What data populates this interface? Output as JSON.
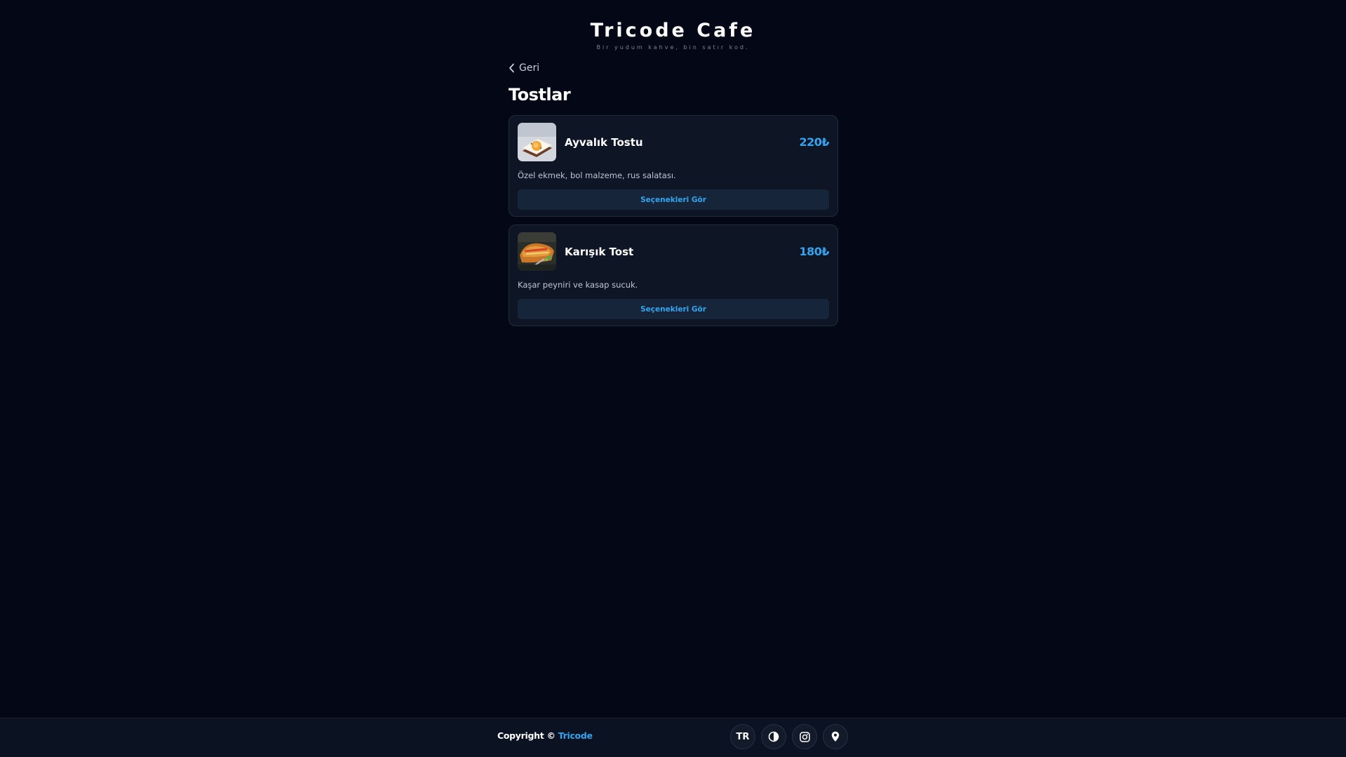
{
  "header": {
    "title": "Tricode Cafe",
    "subtitle": "Bir yudum kahve, bin satır kod."
  },
  "nav": {
    "back_label": "Geri"
  },
  "category": {
    "title": "Tostlar"
  },
  "products": [
    {
      "name": "Ayvalık Tostu",
      "price": "220₺",
      "description": "Özel ekmek, bol malzeme, rus salatası.",
      "button_label": "Seçenekleri Gör"
    },
    {
      "name": "Karışık Tost",
      "price": "180₺",
      "description": "Kaşar peyniri ve kasap sucuk.",
      "button_label": "Seçenekleri Gör"
    }
  ],
  "footer": {
    "copyright_prefix": "Copyright ©",
    "copyright_brand": "Tricode",
    "language_label": "TR",
    "icons": [
      "theme-toggle-icon",
      "instagram-icon",
      "location-pin-icon"
    ]
  },
  "colors": {
    "background": "#040816",
    "card": "#0e1525",
    "accent": "#34a4f0",
    "button_bg": "#17253a",
    "footer_bg": "#0b1221"
  }
}
